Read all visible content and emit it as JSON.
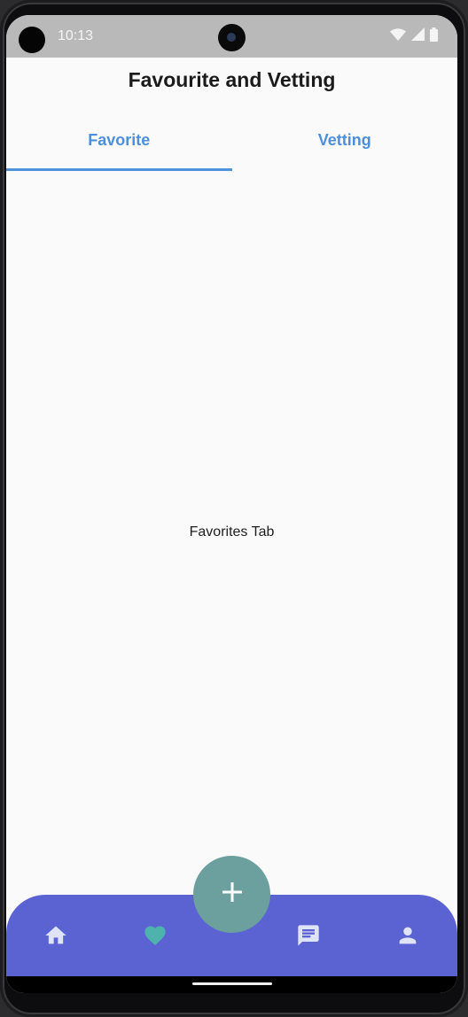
{
  "status_bar": {
    "time": "10:13",
    "icons": [
      "wifi-icon",
      "cellular-signal-icon",
      "battery-icon"
    ]
  },
  "app_bar": {
    "title": "Favourite and Vetting"
  },
  "tabs": [
    {
      "label": "Favorite",
      "selected": true
    },
    {
      "label": "Vetting",
      "selected": false
    }
  ],
  "content": {
    "text": "Favorites Tab"
  },
  "bottom_nav": {
    "items": [
      {
        "icon": "home-icon",
        "active": false
      },
      {
        "icon": "heart-icon",
        "active": true
      },
      {
        "icon": "chat-icon",
        "active": false
      },
      {
        "icon": "person-icon",
        "active": false
      }
    ],
    "fab_icon": "plus-icon"
  },
  "colors": {
    "accent_blue": "#4d8fdb",
    "nav_background": "#5b63d3",
    "fab_background": "#6ba09e",
    "active_icon": "#4fb3ad",
    "inactive_icon": "#dfe3f7"
  }
}
